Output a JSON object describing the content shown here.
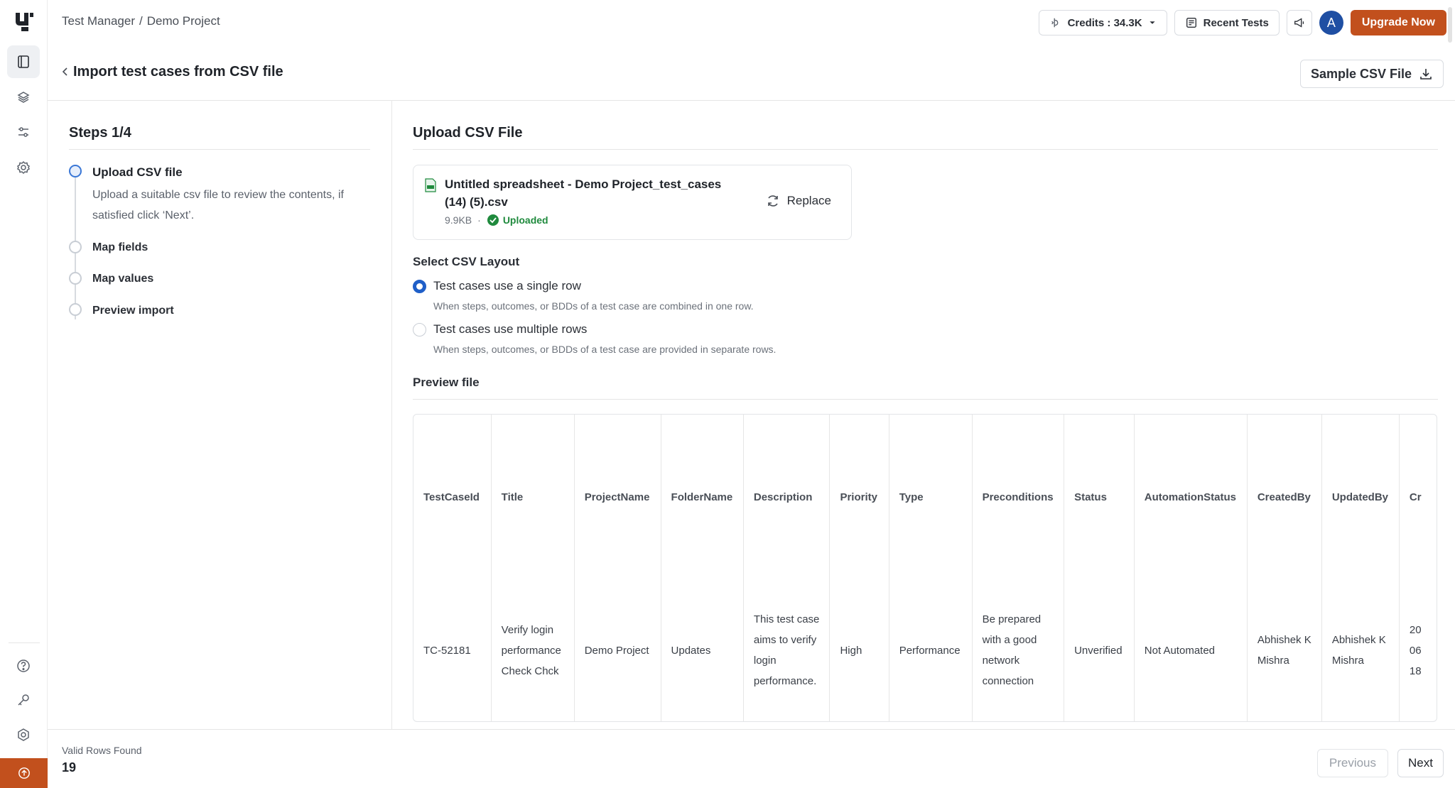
{
  "breadcrumb": {
    "root": "Test Manager",
    "separator": "/",
    "project": "Demo Project"
  },
  "topbar": {
    "credits_label": "Credits : 34.3K",
    "recent_tests_label": "Recent Tests",
    "avatar_initial": "A",
    "upgrade_label": "Upgrade Now"
  },
  "page": {
    "title": "Import test cases from CSV file",
    "sample_button": "Sample CSV File"
  },
  "steps": {
    "title": "Steps 1/4",
    "items": [
      {
        "label": "Upload CSV file",
        "description": "Upload a suitable csv file to review the contents, if satisfied click ‘Next’."
      },
      {
        "label": "Map fields"
      },
      {
        "label": "Map values"
      },
      {
        "label": "Preview import"
      }
    ]
  },
  "upload": {
    "title": "Upload CSV File",
    "file_name": "Untitled spreadsheet - Demo Project_test_cases (14) (5).csv",
    "file_size": "9.9KB",
    "dot": "·",
    "status": "Uploaded",
    "replace_label": "Replace"
  },
  "layout": {
    "title": "Select CSV Layout",
    "options": [
      {
        "label": "Test cases use a single row",
        "help": "When steps, outcomes, or BDDs of a test case are combined in one row.",
        "checked": true
      },
      {
        "label": "Test cases use multiple rows",
        "help": "When steps, outcomes, or BDDs of a test case are provided in separate rows.",
        "checked": false
      }
    ]
  },
  "preview": {
    "title": "Preview file",
    "columns": [
      "TestCaseId",
      "Title",
      "ProjectName",
      "FolderName",
      "Description",
      "Priority",
      "Type",
      "Preconditions",
      "Status",
      "AutomationStatus",
      "CreatedBy",
      "UpdatedBy",
      "Cr"
    ],
    "row": [
      "TC-52181",
      "Verify login performance Check Chck",
      "Demo Project",
      "Updates",
      "This test case aims to verify login performance.",
      "High",
      "Performance",
      "Be prepared with a good network connection",
      "Unverified",
      "Not Automated",
      "Abhishek K Mishra",
      "Abhishek K Mishra",
      "20 06 18"
    ]
  },
  "footer": {
    "valid_label": "Valid Rows Found",
    "valid_count": "19",
    "previous_label": "Previous",
    "next_label": "Next"
  },
  "colors": {
    "accent": "#c2501d",
    "primary": "#1f5fc8",
    "success": "#1f8a3d"
  }
}
